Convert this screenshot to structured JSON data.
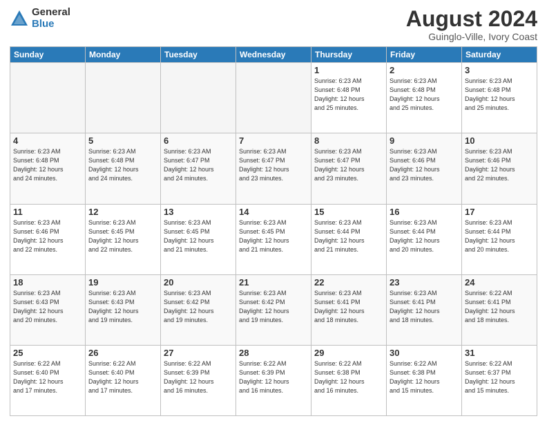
{
  "header": {
    "logo_line1": "General",
    "logo_line2": "Blue",
    "month_year": "August 2024",
    "location": "Guinglo-Ville, Ivory Coast"
  },
  "weekdays": [
    "Sunday",
    "Monday",
    "Tuesday",
    "Wednesday",
    "Thursday",
    "Friday",
    "Saturday"
  ],
  "weeks": [
    [
      {
        "day": "",
        "info": ""
      },
      {
        "day": "",
        "info": ""
      },
      {
        "day": "",
        "info": ""
      },
      {
        "day": "",
        "info": ""
      },
      {
        "day": "1",
        "info": "Sunrise: 6:23 AM\nSunset: 6:48 PM\nDaylight: 12 hours\nand 25 minutes."
      },
      {
        "day": "2",
        "info": "Sunrise: 6:23 AM\nSunset: 6:48 PM\nDaylight: 12 hours\nand 25 minutes."
      },
      {
        "day": "3",
        "info": "Sunrise: 6:23 AM\nSunset: 6:48 PM\nDaylight: 12 hours\nand 25 minutes."
      }
    ],
    [
      {
        "day": "4",
        "info": "Sunrise: 6:23 AM\nSunset: 6:48 PM\nDaylight: 12 hours\nand 24 minutes."
      },
      {
        "day": "5",
        "info": "Sunrise: 6:23 AM\nSunset: 6:48 PM\nDaylight: 12 hours\nand 24 minutes."
      },
      {
        "day": "6",
        "info": "Sunrise: 6:23 AM\nSunset: 6:47 PM\nDaylight: 12 hours\nand 24 minutes."
      },
      {
        "day": "7",
        "info": "Sunrise: 6:23 AM\nSunset: 6:47 PM\nDaylight: 12 hours\nand 23 minutes."
      },
      {
        "day": "8",
        "info": "Sunrise: 6:23 AM\nSunset: 6:47 PM\nDaylight: 12 hours\nand 23 minutes."
      },
      {
        "day": "9",
        "info": "Sunrise: 6:23 AM\nSunset: 6:46 PM\nDaylight: 12 hours\nand 23 minutes."
      },
      {
        "day": "10",
        "info": "Sunrise: 6:23 AM\nSunset: 6:46 PM\nDaylight: 12 hours\nand 22 minutes."
      }
    ],
    [
      {
        "day": "11",
        "info": "Sunrise: 6:23 AM\nSunset: 6:46 PM\nDaylight: 12 hours\nand 22 minutes."
      },
      {
        "day": "12",
        "info": "Sunrise: 6:23 AM\nSunset: 6:45 PM\nDaylight: 12 hours\nand 22 minutes."
      },
      {
        "day": "13",
        "info": "Sunrise: 6:23 AM\nSunset: 6:45 PM\nDaylight: 12 hours\nand 21 minutes."
      },
      {
        "day": "14",
        "info": "Sunrise: 6:23 AM\nSunset: 6:45 PM\nDaylight: 12 hours\nand 21 minutes."
      },
      {
        "day": "15",
        "info": "Sunrise: 6:23 AM\nSunset: 6:44 PM\nDaylight: 12 hours\nand 21 minutes."
      },
      {
        "day": "16",
        "info": "Sunrise: 6:23 AM\nSunset: 6:44 PM\nDaylight: 12 hours\nand 20 minutes."
      },
      {
        "day": "17",
        "info": "Sunrise: 6:23 AM\nSunset: 6:44 PM\nDaylight: 12 hours\nand 20 minutes."
      }
    ],
    [
      {
        "day": "18",
        "info": "Sunrise: 6:23 AM\nSunset: 6:43 PM\nDaylight: 12 hours\nand 20 minutes."
      },
      {
        "day": "19",
        "info": "Sunrise: 6:23 AM\nSunset: 6:43 PM\nDaylight: 12 hours\nand 19 minutes."
      },
      {
        "day": "20",
        "info": "Sunrise: 6:23 AM\nSunset: 6:42 PM\nDaylight: 12 hours\nand 19 minutes."
      },
      {
        "day": "21",
        "info": "Sunrise: 6:23 AM\nSunset: 6:42 PM\nDaylight: 12 hours\nand 19 minutes."
      },
      {
        "day": "22",
        "info": "Sunrise: 6:23 AM\nSunset: 6:41 PM\nDaylight: 12 hours\nand 18 minutes."
      },
      {
        "day": "23",
        "info": "Sunrise: 6:23 AM\nSunset: 6:41 PM\nDaylight: 12 hours\nand 18 minutes."
      },
      {
        "day": "24",
        "info": "Sunrise: 6:22 AM\nSunset: 6:41 PM\nDaylight: 12 hours\nand 18 minutes."
      }
    ],
    [
      {
        "day": "25",
        "info": "Sunrise: 6:22 AM\nSunset: 6:40 PM\nDaylight: 12 hours\nand 17 minutes."
      },
      {
        "day": "26",
        "info": "Sunrise: 6:22 AM\nSunset: 6:40 PM\nDaylight: 12 hours\nand 17 minutes."
      },
      {
        "day": "27",
        "info": "Sunrise: 6:22 AM\nSunset: 6:39 PM\nDaylight: 12 hours\nand 16 minutes."
      },
      {
        "day": "28",
        "info": "Sunrise: 6:22 AM\nSunset: 6:39 PM\nDaylight: 12 hours\nand 16 minutes."
      },
      {
        "day": "29",
        "info": "Sunrise: 6:22 AM\nSunset: 6:38 PM\nDaylight: 12 hours\nand 16 minutes."
      },
      {
        "day": "30",
        "info": "Sunrise: 6:22 AM\nSunset: 6:38 PM\nDaylight: 12 hours\nand 15 minutes."
      },
      {
        "day": "31",
        "info": "Sunrise: 6:22 AM\nSunset: 6:37 PM\nDaylight: 12 hours\nand 15 minutes."
      }
    ]
  ]
}
